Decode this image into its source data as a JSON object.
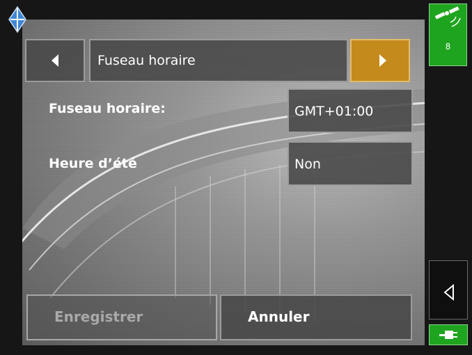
{
  "header": {
    "title": "Fuseau horaire",
    "prev_icon": "triangle-left-icon",
    "next_icon": "triangle-right-icon"
  },
  "settings": {
    "timezone_label": "Fuseau horaire:",
    "timezone_value": "GMT+01:00",
    "dst_label": "Heure d’été",
    "dst_value": "Non"
  },
  "footer": {
    "save_label": "Enregistrer",
    "cancel_label": "Annuler"
  },
  "status": {
    "satellite_count": "8",
    "gps_icon": "satellite-icon",
    "power_icon": "power-plug-icon",
    "back_icon": "back-triangle-icon"
  },
  "colors": {
    "accent_next": "#c58a1c",
    "status_green": "#1fa41f",
    "compass_blue": "#3f86d4"
  }
}
